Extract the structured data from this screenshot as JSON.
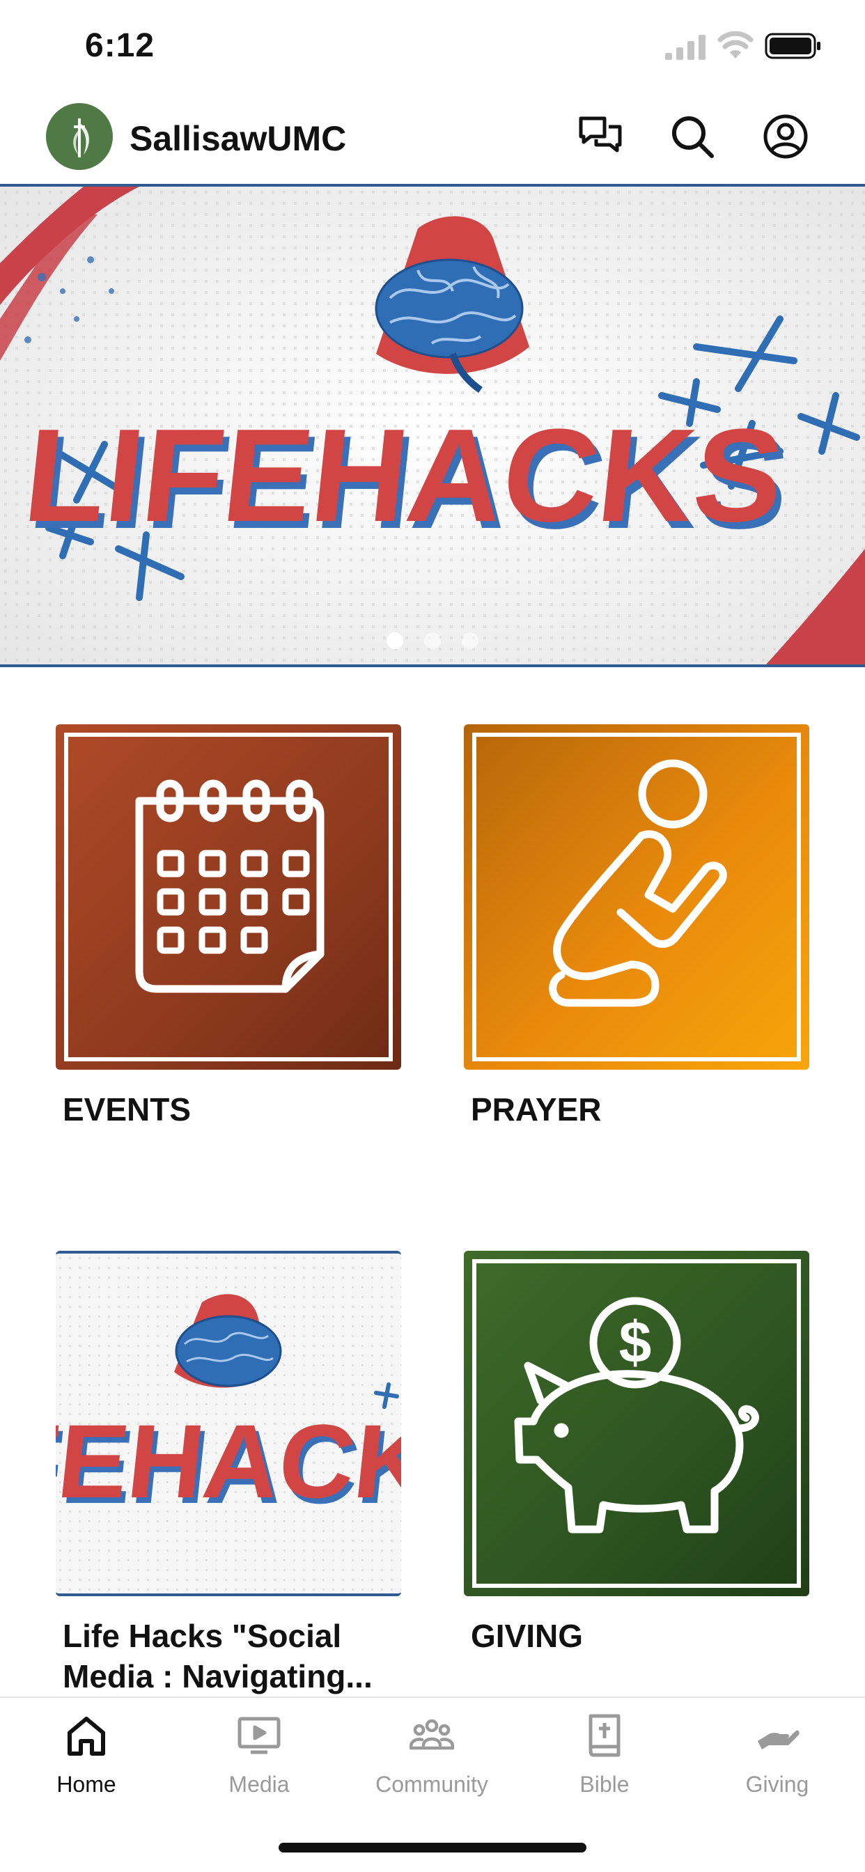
{
  "status_bar": {
    "time": "6:12"
  },
  "header": {
    "app_title": "SallisawUMC",
    "icons": [
      "chat-icon",
      "search-icon",
      "account-icon"
    ]
  },
  "banner": {
    "text": "LIFEHACKS",
    "slides": 3,
    "active_slide": 1
  },
  "tiles": [
    {
      "label": "EVENTS",
      "icon": "calendar-icon",
      "color": "#9b4222"
    },
    {
      "label": "PRAYER",
      "icon": "praying-person-icon",
      "color": "#e98a0c"
    },
    {
      "label": "Life Hacks \"Social Media : Navigating...",
      "icon": "lifehacks-thumbnail",
      "thumb_text": "LIFEHACKS"
    },
    {
      "label": "GIVING",
      "icon": "piggy-bank-icon",
      "color": "#2e5420"
    }
  ],
  "nav": {
    "items": [
      {
        "label": "Home",
        "icon": "home-icon",
        "active": true
      },
      {
        "label": "Media",
        "icon": "tv-icon",
        "active": false
      },
      {
        "label": "Community",
        "icon": "people-icon",
        "active": false
      },
      {
        "label": "Bible",
        "icon": "bible-icon",
        "active": false
      },
      {
        "label": "Giving",
        "icon": "giving-hand-icon",
        "active": false
      }
    ]
  },
  "colors": {
    "accent_blue": "#2f5a92",
    "brain_blue": "#2f6db5",
    "lifehacks_red": "#d24545"
  }
}
